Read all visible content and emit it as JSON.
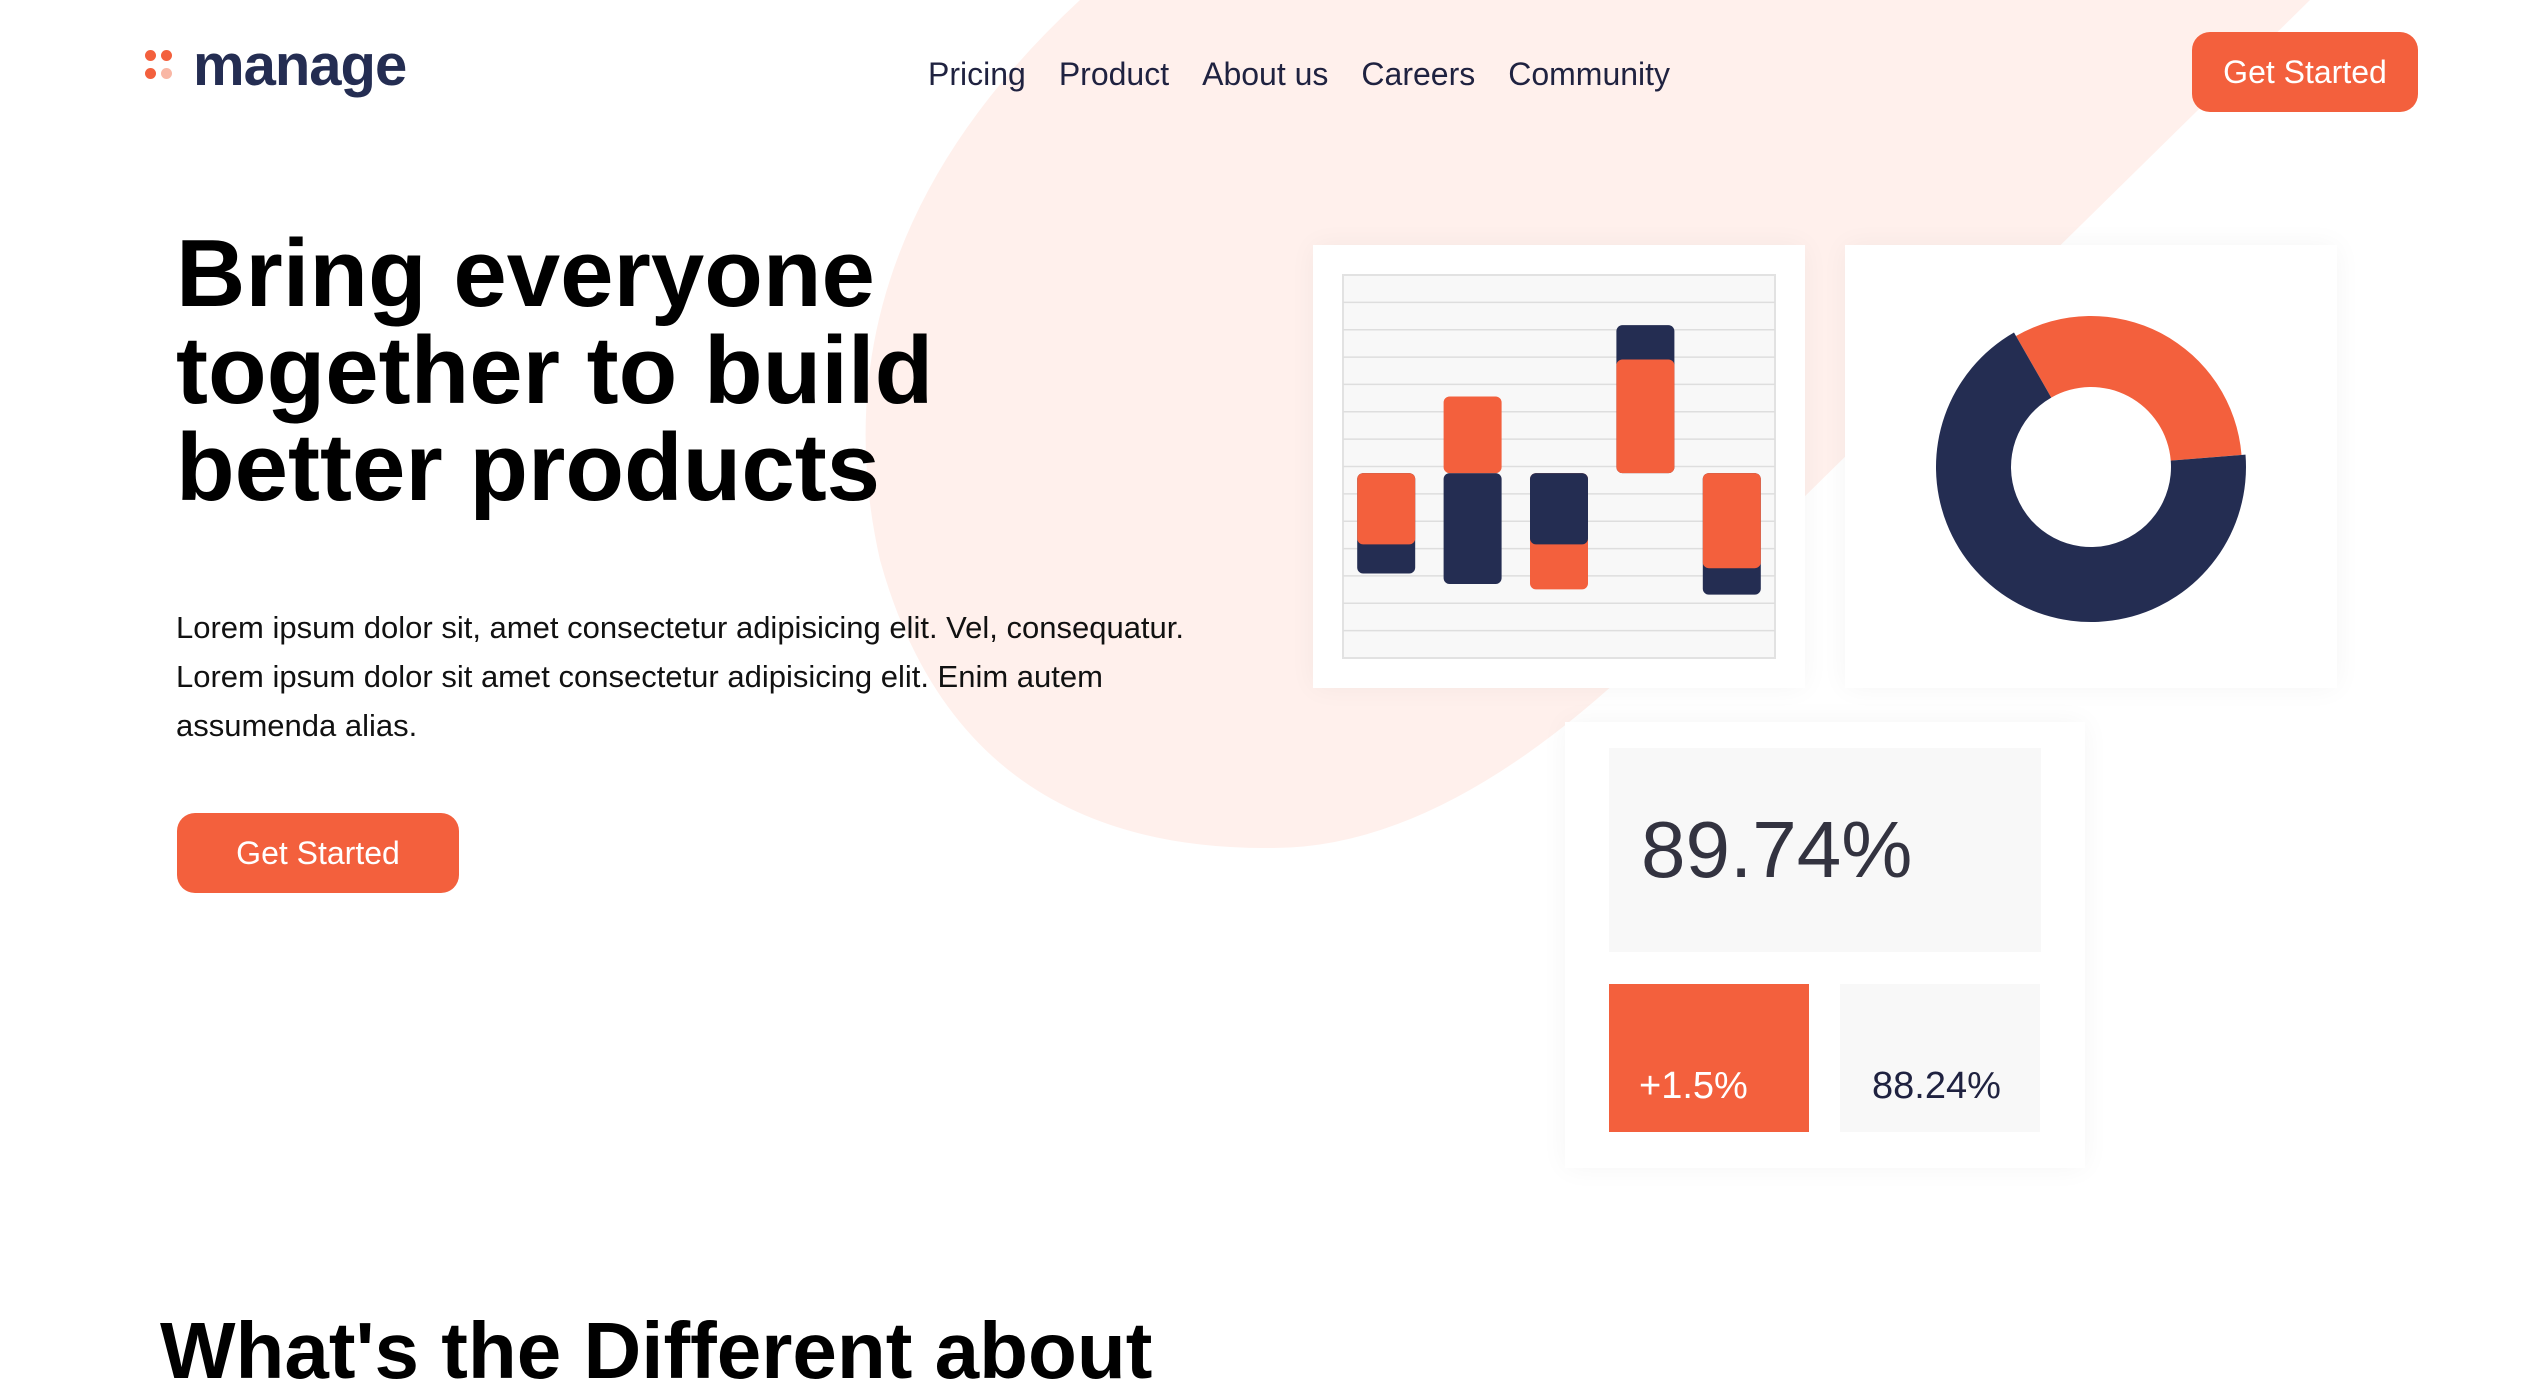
{
  "brand": {
    "name": "manage",
    "colors": {
      "accent": "#f3603d",
      "navy": "#242d52",
      "blob": "#fff0ec"
    }
  },
  "nav": {
    "items": [
      {
        "label": "Pricing"
      },
      {
        "label": "Product"
      },
      {
        "label": "About us"
      },
      {
        "label": "Careers"
      },
      {
        "label": "Community"
      }
    ],
    "cta_label": "Get Started"
  },
  "hero": {
    "headline": "Bring everyone together to build better products",
    "body": "Lorem ipsum dolor sit, amet consectetur adipisicing elit. Vel, consequatur. Lorem ipsum dolor sit amet consectetur adipisicing elit. Enim autem assumenda alias.",
    "cta_label": "Get Started"
  },
  "stats": {
    "main": "89.74%",
    "change": "+1.5%",
    "secondary": "88.24%"
  },
  "chart_data": [
    {
      "type": "bar",
      "title": "",
      "series": [
        {
          "color": "#f3603d",
          "values": [
            -2.7,
            2.9,
            -4.4,
            4.3,
            -3.6
          ]
        },
        {
          "color": "#242d52",
          "values": [
            -3.8,
            -4.2,
            -2.7,
            5.6,
            -4.6
          ]
        }
      ],
      "ylim": [
        -7,
        7.5
      ],
      "grid": true
    },
    {
      "type": "pie",
      "donut": true,
      "slices": [
        {
          "value": 32,
          "color": "#f3603d"
        },
        {
          "value": 68,
          "color": "#242d52"
        }
      ]
    }
  ],
  "section": {
    "heading": "What's the Different about"
  }
}
